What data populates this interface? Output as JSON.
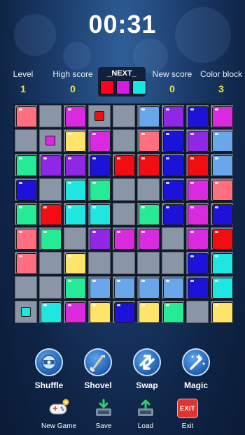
{
  "timer": "00:31",
  "stats": {
    "level": {
      "label": "Level",
      "value": "1"
    },
    "high_score": {
      "label": "High score",
      "value": "0"
    },
    "new_score": {
      "label": "New score",
      "value": "0"
    },
    "color_block": {
      "label": "Color block",
      "value": "3"
    }
  },
  "next": {
    "label": "_NEXT_",
    "colors": [
      "#ff0022",
      "#d81be0",
      "#18e6df"
    ]
  },
  "palette": {
    "R": "#ff6f7f",
    "r": "#f10d12",
    "M": "#da2adf",
    "V": "#9027e4",
    "B": "#1c12d8",
    "S": "#6aa6ea",
    "C": "#1fe6e0",
    "G": "#25ea96",
    "Y": "#fee46a"
  },
  "board": {
    "rows": [
      [
        "R",
        "E",
        "M",
        "E",
        "E",
        "S",
        "V",
        "B",
        "M"
      ],
      [
        "E",
        "E",
        "Y",
        "M",
        "E",
        "R",
        "B",
        "V",
        "S"
      ],
      [
        "G",
        "V",
        "V",
        "B",
        "r",
        "r",
        "B",
        "r",
        "S"
      ],
      [
        "B",
        "E",
        "C",
        "G",
        "E",
        "E",
        "B",
        "M",
        "R"
      ],
      [
        "G",
        "r",
        "C",
        "C",
        "E",
        "G",
        "B",
        "M",
        "B"
      ],
      [
        "R",
        "G",
        "E",
        "V",
        "M",
        "M",
        "E",
        "M",
        "r"
      ],
      [
        "R",
        "E",
        "Y",
        "E",
        "E",
        "E",
        "E",
        "B",
        "C"
      ],
      [
        "E",
        "E",
        "G",
        "S",
        "S",
        "S",
        "S",
        "B",
        "C"
      ],
      [
        "E",
        "C",
        "M",
        "Y",
        "B",
        "Y",
        "G",
        "E",
        "Y"
      ]
    ],
    "previews": [
      {
        "row": 0,
        "col": 3,
        "color": "#f10d12"
      },
      {
        "row": 1,
        "col": 1,
        "color": "#da2adf"
      },
      {
        "row": 8,
        "col": 0,
        "color": "#1fe6e0"
      }
    ]
  },
  "tools": [
    {
      "name": "shuffle",
      "label": "Shuffle",
      "icon": "shuffle-icon"
    },
    {
      "name": "shovel",
      "label": "Shovel",
      "icon": "shovel-icon"
    },
    {
      "name": "swap",
      "label": "Swap",
      "icon": "swap-arrows-icon"
    },
    {
      "name": "magic",
      "label": "Magic",
      "icon": "magic-wand-icon"
    }
  ],
  "menu": [
    {
      "name": "new-game",
      "label": "New Game",
      "icon": "gamepad-icon"
    },
    {
      "name": "save",
      "label": "Save",
      "icon": "save-icon"
    },
    {
      "name": "load",
      "label": "Load",
      "icon": "load-icon"
    },
    {
      "name": "exit",
      "label": "Exit",
      "icon": "exit-icon",
      "badge": "EXIT"
    }
  ]
}
